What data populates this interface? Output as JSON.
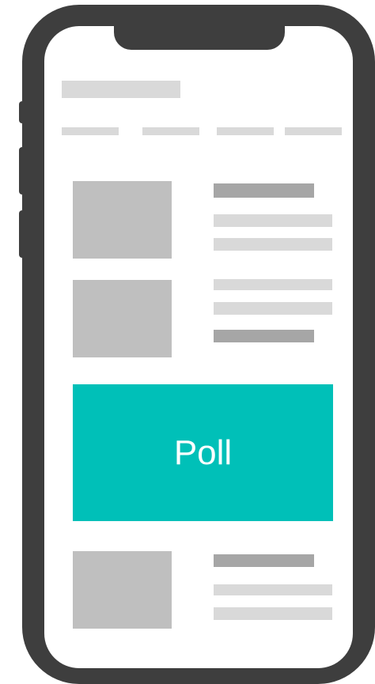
{
  "poll": {
    "label": "Poll"
  },
  "colors": {
    "frame": "#3e3e3e",
    "placeholder_light": "#d9d9d9",
    "placeholder_mid": "#a6a6a6",
    "thumbnail": "#bfbfbf",
    "poll_background": "#00c0b8",
    "poll_text": "#ffffff"
  }
}
